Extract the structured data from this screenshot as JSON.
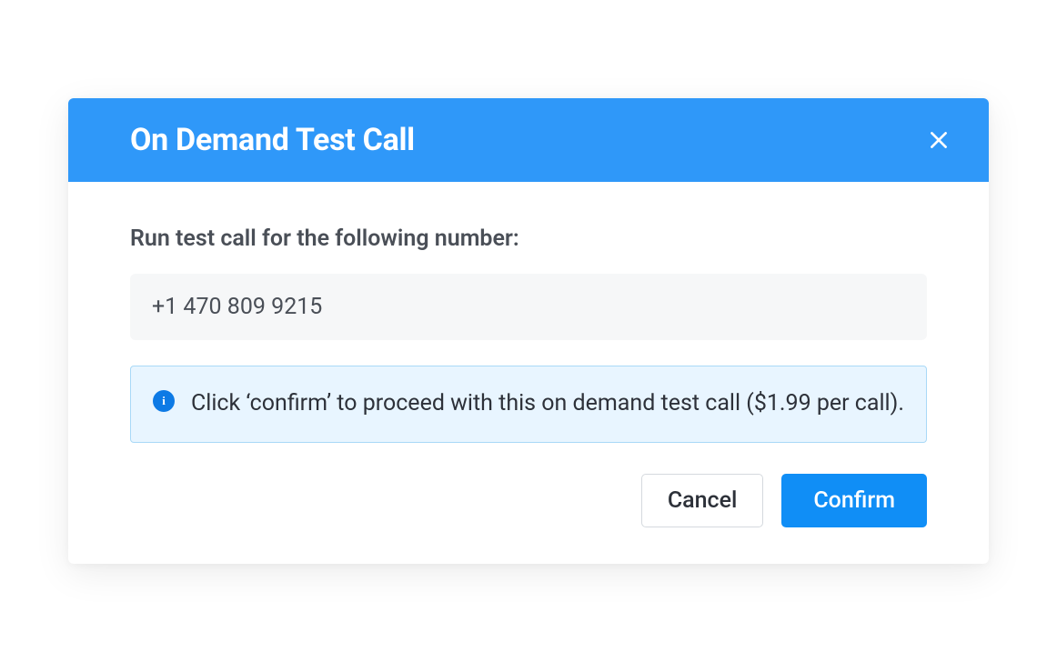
{
  "modal": {
    "title": "On Demand Test Call",
    "prompt": "Run test call for the following number:",
    "phone_value": "+1 470 809 9215",
    "info_message": "Click ‘confirm’ to proceed with this on demand test call ($1.99 per call).",
    "cancel_label": "Cancel",
    "confirm_label": "Confirm"
  }
}
